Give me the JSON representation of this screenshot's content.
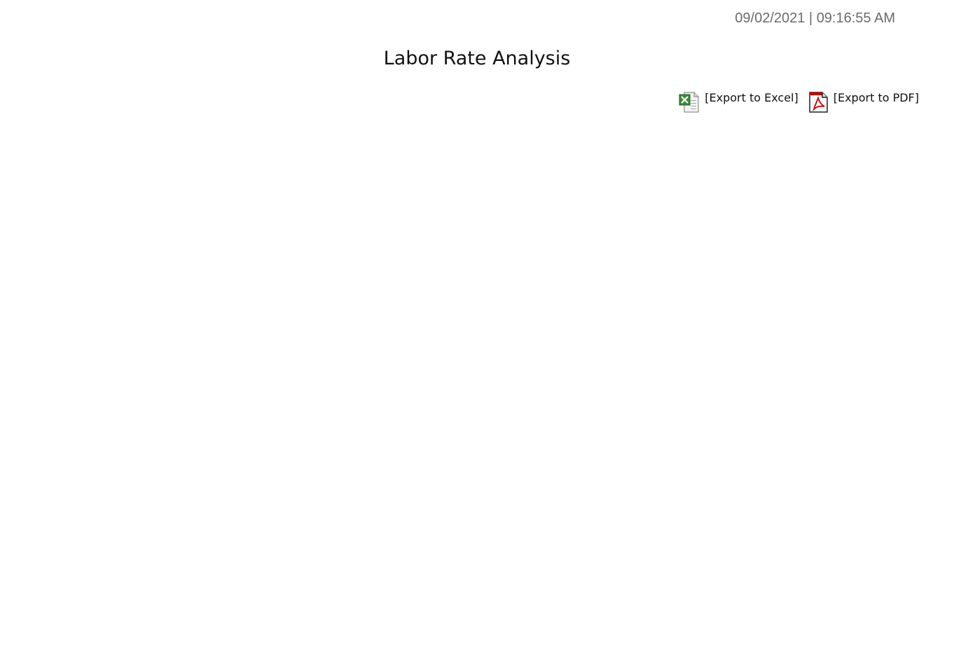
{
  "header": {
    "timestamp": "09/02/2021 | 09:16:55 AM",
    "title": "Labor Rate Analysis"
  },
  "exports": {
    "excel": {
      "label": "[Export to Excel]",
      "icon": "excel-file-icon",
      "accent": "#2e7d32"
    },
    "pdf": {
      "label": "[Export to PDF]",
      "icon": "pdf-file-icon",
      "accent": "#c00000"
    }
  }
}
